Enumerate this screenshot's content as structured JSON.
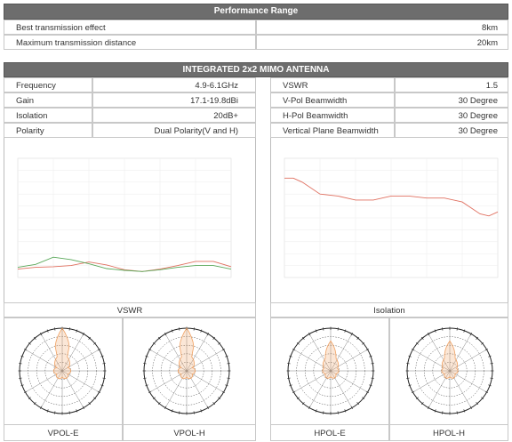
{
  "performance": {
    "title": "Performance Range",
    "rows": [
      {
        "label": "Best transmission effect",
        "value": "8km"
      },
      {
        "label": "Maximum transmission distance",
        "value": "20km"
      }
    ]
  },
  "antenna": {
    "title": "INTEGRATED 2x2 MIMO ANTENNA",
    "left_rows": [
      {
        "label": "Frequency",
        "value": "4.9-6.1GHz"
      },
      {
        "label": "Gain",
        "value": "17.1-19.8dBi"
      },
      {
        "label": "Isolation",
        "value": "20dB+"
      },
      {
        "label": "Polarity",
        "value": "Dual Polarity(V and H)"
      }
    ],
    "right_rows": [
      {
        "label": "VSWR",
        "value": "1.5"
      },
      {
        "label": "V-Pol Beamwidth",
        "value": "30 Degree"
      },
      {
        "label": "H-Pol Beamwidth",
        "value": "30 Degree"
      },
      {
        "label": "Vertical Plane Beamwidth",
        "value": "30 Degree"
      }
    ]
  },
  "chart_captions": {
    "vswr": "VSWR",
    "isolation": "Isolation"
  },
  "polar_captions": [
    "VPOL-E",
    "VPOL-H",
    "HPOL-E",
    "HPOL-H"
  ],
  "colors": {
    "header_bg": "#6d6d6d",
    "line_red": "#e07060",
    "line_green": "#5aa85a",
    "pattern": "#f0a060"
  },
  "chart_data": [
    {
      "type": "line",
      "title": "VSWR",
      "xlim": [
        4.9,
        6.1
      ],
      "ylim": [
        1.0,
        3.0
      ],
      "grid": true,
      "series": [
        {
          "values": [
            [
              4.9,
              1.14
            ],
            [
              5.0,
              1.17
            ],
            [
              5.1,
              1.18
            ],
            [
              5.2,
              1.2
            ],
            [
              5.3,
              1.26
            ],
            [
              5.4,
              1.21
            ],
            [
              5.5,
              1.13
            ],
            [
              5.6,
              1.1
            ],
            [
              5.7,
              1.14
            ],
            [
              5.8,
              1.2
            ],
            [
              5.9,
              1.27
            ],
            [
              6.0,
              1.27
            ],
            [
              6.1,
              1.18
            ]
          ]
        },
        {
          "values": [
            [
              4.9,
              1.17
            ],
            [
              5.0,
              1.22
            ],
            [
              5.1,
              1.34
            ],
            [
              5.2,
              1.3
            ],
            [
              5.3,
              1.23
            ],
            [
              5.4,
              1.15
            ],
            [
              5.5,
              1.12
            ],
            [
              5.6,
              1.1
            ],
            [
              5.7,
              1.13
            ],
            [
              5.8,
              1.17
            ],
            [
              5.9,
              1.2
            ],
            [
              6.0,
              1.2
            ],
            [
              6.1,
              1.14
            ]
          ]
        }
      ]
    },
    {
      "type": "line",
      "title": "Isolation",
      "xlim": [
        4.9,
        6.1
      ],
      "ylim": [
        -60,
        0
      ],
      "grid": true,
      "series": [
        {
          "values": [
            [
              4.9,
              -10
            ],
            [
              4.95,
              -10
            ],
            [
              5.0,
              -12
            ],
            [
              5.1,
              -18
            ],
            [
              5.2,
              -19
            ],
            [
              5.3,
              -21
            ],
            [
              5.4,
              -21
            ],
            [
              5.5,
              -19
            ],
            [
              5.6,
              -19
            ],
            [
              5.7,
              -20
            ],
            [
              5.8,
              -20
            ],
            [
              5.9,
              -22
            ],
            [
              6.0,
              -28
            ],
            [
              6.05,
              -29
            ],
            [
              6.1,
              -27
            ]
          ]
        }
      ]
    }
  ]
}
